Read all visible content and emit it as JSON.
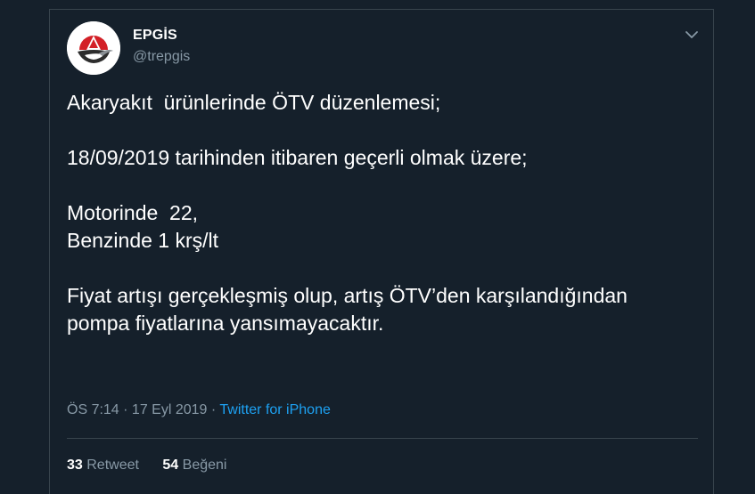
{
  "author": {
    "name": "EPGİS",
    "handle": "@trepgis"
  },
  "tweet": {
    "text": "Akaryakıt  ürünlerinde ÖTV düzenlemesi;\n\n18/09/2019 tarihinden itibaren geçerli olmak üzere;\n\nMotorinde  22,\nBenzinde 1 krş/lt\n\nFiyat artışı gerçekleşmiş olup, artış ÖTV’den karşılandığından pompa fiyatlarına yansımayacaktır.",
    "time": "ÖS 7:14",
    "separator": " · ",
    "date": "17 Eyl 2019",
    "source": "Twitter for iPhone"
  },
  "stats": {
    "retweets_count": "33",
    "retweets_label": "Retweet",
    "likes_count": "54",
    "likes_label": "Beğeni"
  },
  "icons": {
    "menu": "chevron-down-icon",
    "avatar": "epgis-logo"
  },
  "colors": {
    "background": "#15202b",
    "secondary_text": "#8899a6",
    "link": "#1da1f2",
    "border": "#38444d"
  }
}
